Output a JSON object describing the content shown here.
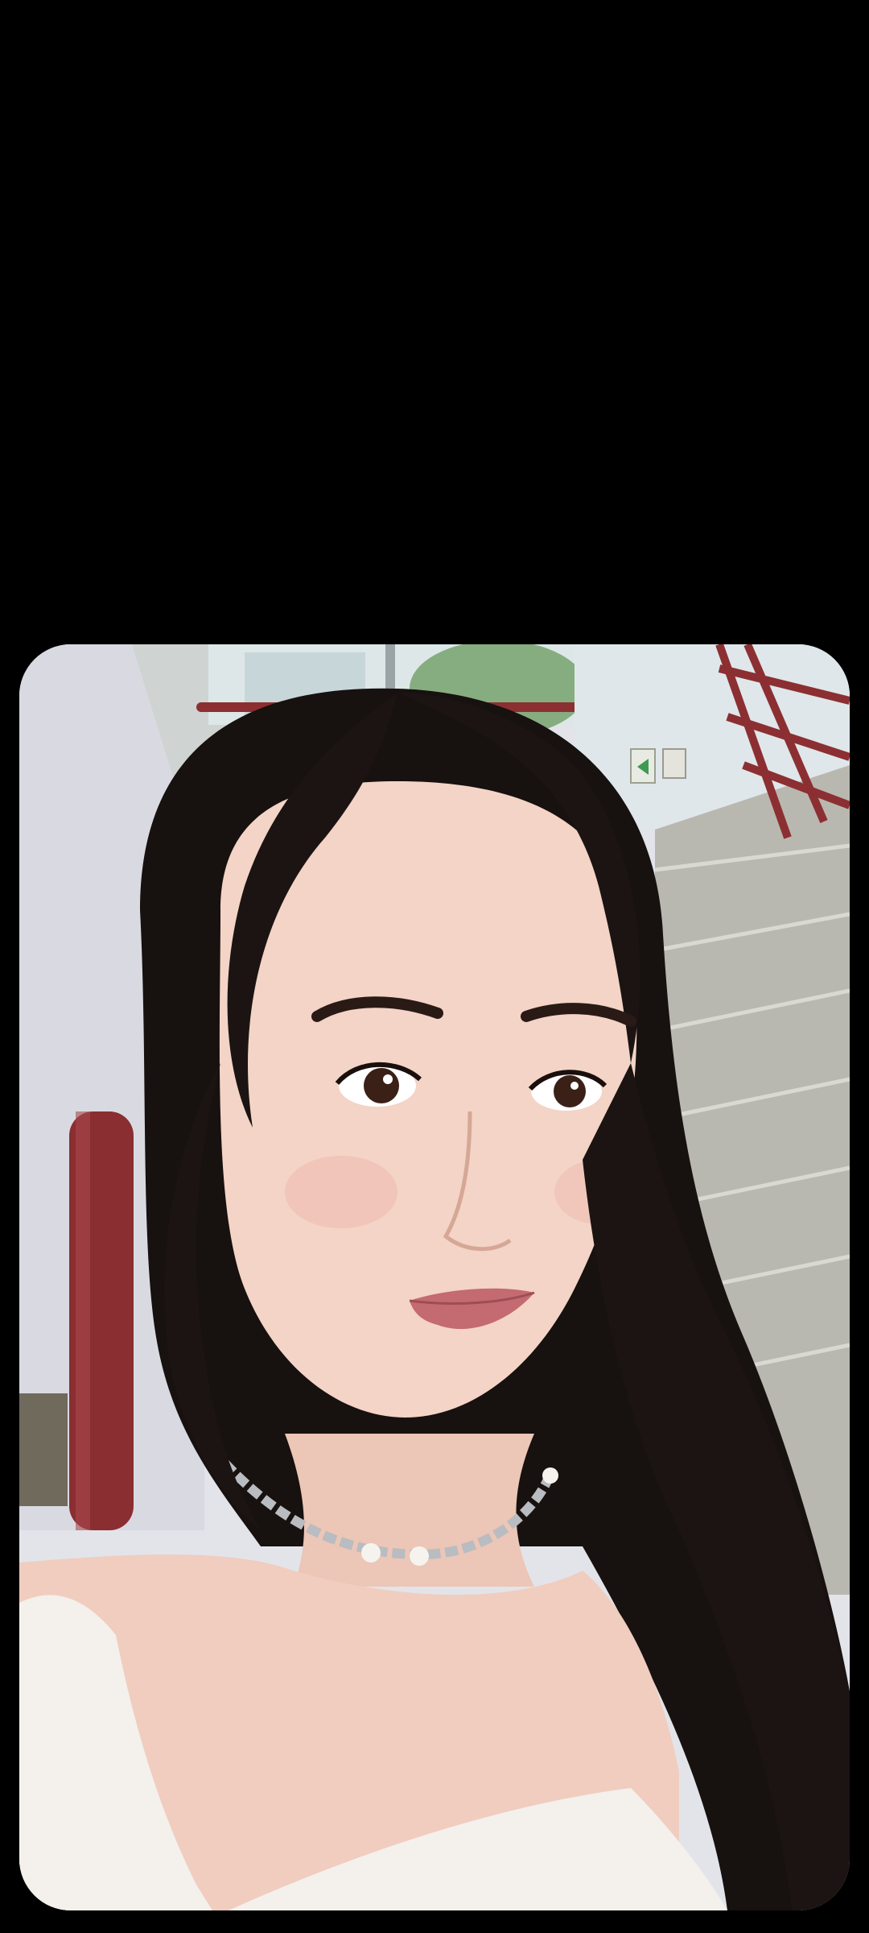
{
  "screen": {
    "background_color": "#000000"
  },
  "photo": {
    "subject_icon": "selfie-photo",
    "palette": {
      "wall": "#e6e7ec",
      "wall_shadow": "#c9cad0",
      "window_sky": "#dfe8ea",
      "window_greenery": "#7fa77a",
      "railing": "#8c2f32",
      "stairs": "#b9b8b0",
      "stair_edge": "#d7d6d0",
      "hair": "#17110f",
      "skin": "#f2d2c4",
      "skin_shadow": "#dfb2a0",
      "lips": "#c46a71",
      "top": "#f4f0ec",
      "necklace": "#b9bcc0",
      "pearl": "#f6f3ee",
      "exit_sign": "#3f9a4f"
    }
  }
}
